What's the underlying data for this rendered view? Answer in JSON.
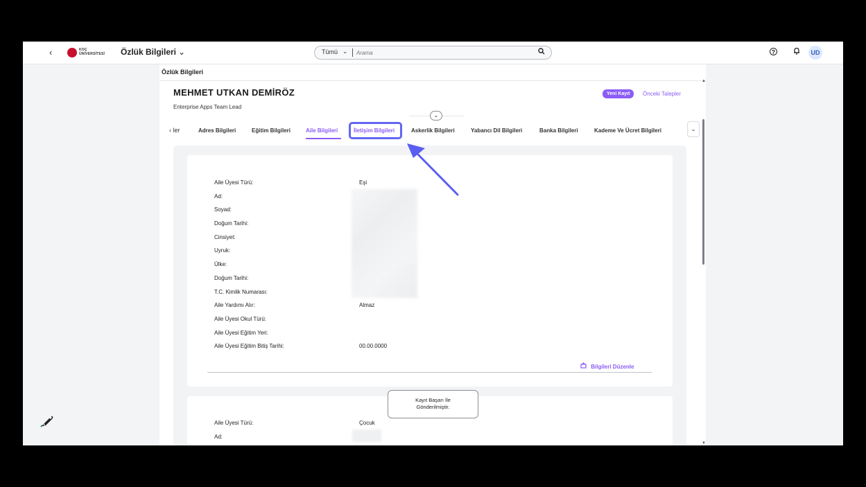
{
  "shell": {
    "back_icon": "chevron-left-icon",
    "brand_line1": "KOÇ",
    "brand_line2": "ÜNİVERSİTESİ",
    "app_title": "Özlük Bilgileri",
    "app_title_chevron": "⌄",
    "search_scope": "Tümü",
    "search_scope_chevron": "⌄",
    "search_placeholder": "Arama",
    "search_icon": "⚲",
    "help_icon": "?",
    "bell_icon": "🔔︎",
    "avatar_initials": "UD"
  },
  "page": {
    "title": "Özlük Bilgileri",
    "employee_name": "MEHMET UTKAN DEMİRÖZ",
    "employee_role": "Enterprise Apps Team Lead",
    "new_record_button": "Yeni Kayıt",
    "previous_requests_button": "Önceki Talepler",
    "collapse_icon": "⌄"
  },
  "tabs": {
    "left_label": "‹ ler",
    "items": [
      {
        "label": "Adres Bilgileri"
      },
      {
        "label": "Eğitim Bilgileri"
      },
      {
        "label": "Aile Bilgileri",
        "active": true
      },
      {
        "label": "İletişim Bilgileri",
        "highlighted": true
      },
      {
        "label": "Askerlik Bilgileri"
      },
      {
        "label": "Yabancı Dil Bilgileri"
      },
      {
        "label": "Banka Bilgileri"
      },
      {
        "label": "Kademe Ve Ücret Bilgileri"
      }
    ],
    "more_icon": "⌄"
  },
  "card1": {
    "fields": [
      {
        "label": "Aile Üyesi Türü:",
        "value": "Eşi"
      },
      {
        "label": "Ad:",
        "value": ""
      },
      {
        "label": "Soyad:",
        "value": ""
      },
      {
        "label": "Doğum Tarihi:",
        "value": ""
      },
      {
        "label": "Cinsiyet:",
        "value": ""
      },
      {
        "label": "Uyruk:",
        "value": ""
      },
      {
        "label": "Ülke:",
        "value": ""
      },
      {
        "label": "Doğum Tarihi:",
        "value": ""
      },
      {
        "label": "T.C. Kimlik Numarası:",
        "value": ""
      },
      {
        "label": "Aile Yardımı Alır:",
        "value": "Almaz"
      },
      {
        "label": "Aile Üyesi Okul Türü:",
        "value": ""
      },
      {
        "label": "Aile Üyesi Eğitim Yeri:",
        "value": ""
      },
      {
        "label": "Aile Üyesi Eğitim Bitiş Tarihi:",
        "value": "00.00.0000"
      }
    ],
    "edit_label": "Bilgileri Düzenle"
  },
  "card2": {
    "fields": [
      {
        "label": "Aile Üyesi Türü:",
        "value": "Çocuk"
      },
      {
        "label": "Ad:",
        "value": ""
      }
    ]
  },
  "toast": {
    "line1": "Kayıt Başarı İle",
    "line2": "Gönderilmiştir."
  },
  "colors": {
    "accent": "#8b5cf6",
    "highlight_border": "#6366f1",
    "arrow": "#5b5ef0"
  }
}
